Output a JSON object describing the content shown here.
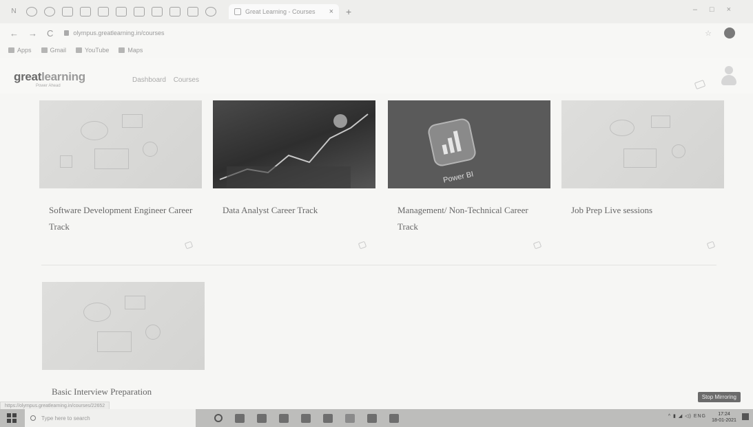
{
  "browser": {
    "toolbar_text": "N",
    "tab_title": "Great Learning - Courses",
    "tab_close": "×",
    "new_tab": "+",
    "url": "olympus.greatlearning.in/courses",
    "bookmarks": [
      "Apps",
      "Gmail",
      "YouTube",
      "Maps"
    ]
  },
  "header": {
    "logo_main": "great",
    "logo_accent": "learning",
    "logo_tagline": "Power Ahead",
    "nav": [
      "Dashboard",
      "Courses"
    ]
  },
  "courses": [
    {
      "title": "Software Development Engineer Career Track",
      "thumb": "illustration"
    },
    {
      "title": "Data Analyst Career Track",
      "thumb": "data-chart-photo"
    },
    {
      "title": "Management/ Non-Technical Career Track",
      "thumb": "power-bi"
    },
    {
      "title": "Job Prep Live sessions",
      "thumb": "illustration"
    },
    {
      "title": "Basic Interview Preparation",
      "thumb": "illustration"
    }
  ],
  "power_bi_label": "Power BI",
  "status_link": "https://olympus.greatlearning.in/courses/22652",
  "stop_button": "Stop Mirroring",
  "taskbar": {
    "search_placeholder": "Type here to search",
    "time": "17:24",
    "date": "18-01-2021",
    "tray_text": "ENG"
  }
}
